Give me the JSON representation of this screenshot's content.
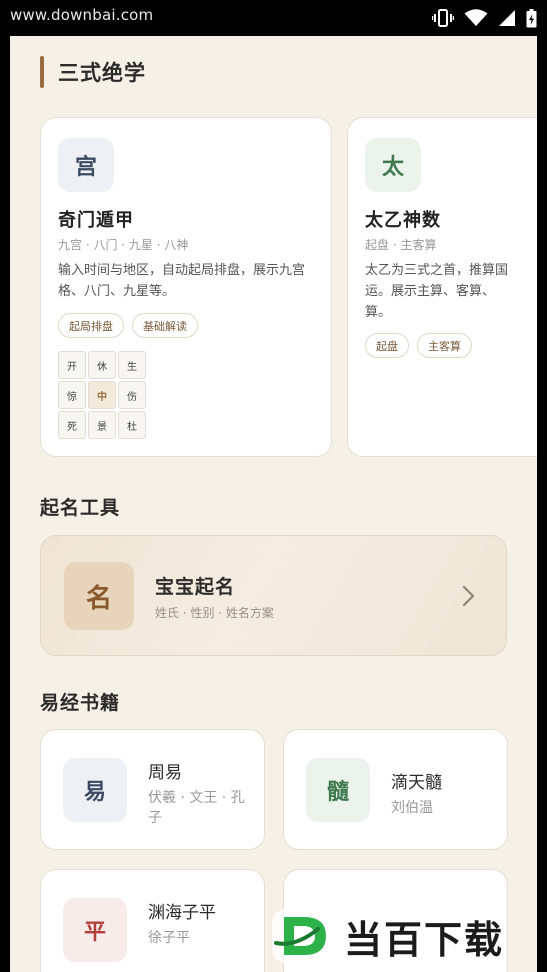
{
  "status_bar": {
    "watermark_url": "www.downbai.com",
    "icons": [
      "vibrate-icon",
      "wifi-icon",
      "signal-icon",
      "battery-icon"
    ]
  },
  "sanshi": {
    "title": "三式绝学",
    "cards": [
      {
        "icon_char": "宫",
        "title": "奇门遁甲",
        "subtitle": "九宫 · 八门 · 九星 · 八神",
        "description": "输入时间与地区，自动起局排盘，展示九宫格、八门、九星等。",
        "tags": [
          "起局排盘",
          "基础解读"
        ],
        "grid": [
          "开",
          "休",
          "生",
          "惊",
          "中",
          "伤",
          "死",
          "景",
          "杜"
        ]
      },
      {
        "icon_char": "太",
        "title": "太乙神数",
        "subtitle": "起盘 · 主客算",
        "description": "太乙为三式之首，推算国运。展示主算、客算、算。",
        "tags": [
          "起盘",
          "主客算"
        ]
      }
    ]
  },
  "naming": {
    "title": "起名工具",
    "card": {
      "icon_char": "名",
      "title": "宝宝起名",
      "subtitle": "姓氏 · 性别 · 姓名方案"
    }
  },
  "books": {
    "title": "易经书籍",
    "items": [
      {
        "icon_char": "易",
        "title": "周易",
        "author": "伏羲 · 文王 · 孔子"
      },
      {
        "icon_char": "髓",
        "title": "滴天髓",
        "author": "刘伯温"
      },
      {
        "icon_char": "平",
        "title": "渊海子平",
        "author": "徐子平"
      }
    ]
  },
  "watermark": {
    "brand": "当百下载",
    "letter": "D"
  },
  "colors": {
    "background": "#f6f1e7",
    "accent_brown": "#9a6b3f",
    "card_border": "#e4ded3",
    "green_icon": "#3f7a4e",
    "red_icon": "#b3403a",
    "blue_icon": "#3b4a63",
    "watermark_green": "#2db24a"
  }
}
